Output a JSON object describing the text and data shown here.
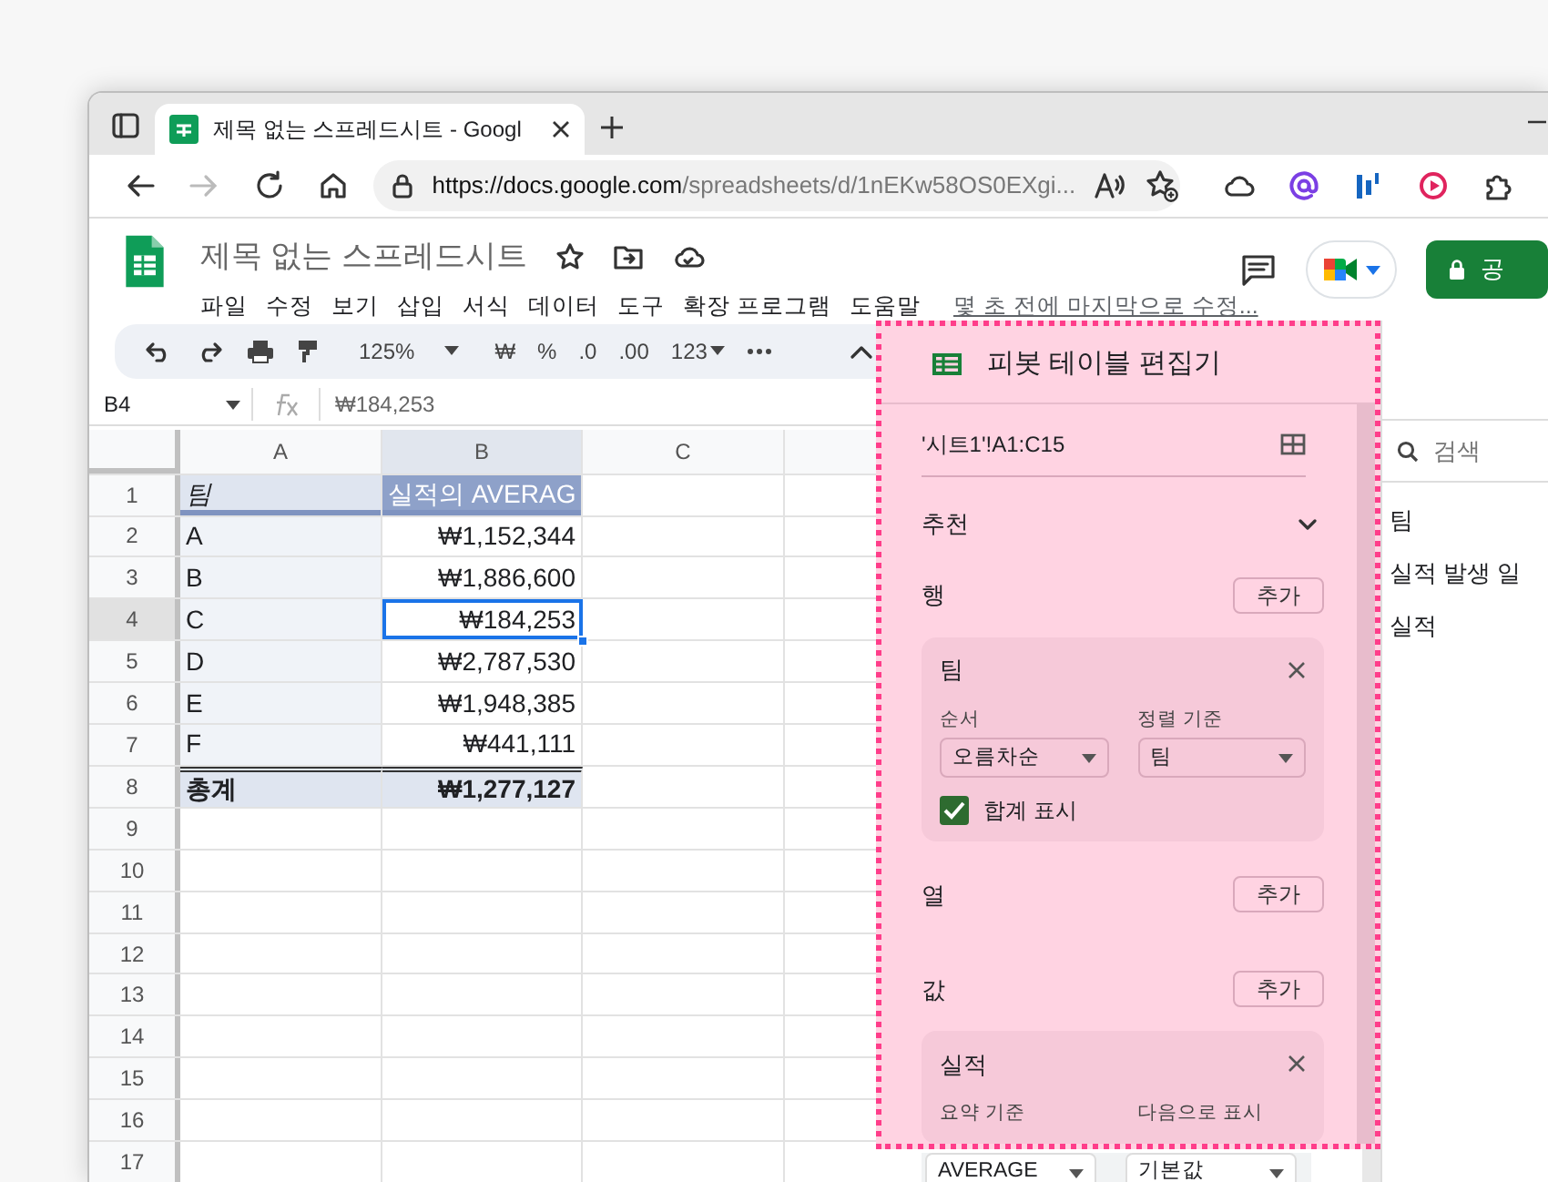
{
  "browser": {
    "tab_title": "제목 없는 스프레드시트 - Googl",
    "url_host": "https://docs.google.com",
    "url_path": "/spreadsheets/d/1nEKw58OS0EXgi..."
  },
  "app": {
    "doc_title": "제목 없는 스프레드시트",
    "menus": [
      "파일",
      "수정",
      "보기",
      "삽입",
      "서식",
      "데이터",
      "도구",
      "확장 프로그램",
      "도움말"
    ],
    "last_edit": "몇 초 전에 마지막으로 수정...",
    "share_button": "공"
  },
  "toolbar": {
    "zoom": "125%",
    "format_items": [
      "₩",
      "%",
      ".0",
      ".00",
      "123"
    ]
  },
  "formula_bar": {
    "cell_ref": "B4",
    "value": "₩184,253"
  },
  "grid": {
    "columns": [
      {
        "label": "A",
        "selected": false
      },
      {
        "label": "B",
        "selected": true
      },
      {
        "label": "C",
        "selected": false
      }
    ],
    "rows": [
      {
        "number": "1",
        "selected": false,
        "kind": "header",
        "cells": [
          {
            "text": "팀",
            "selected": false
          },
          {
            "text": "실적의 AVERAG",
            "selected": false
          }
        ]
      },
      {
        "number": "2",
        "selected": false,
        "kind": "body",
        "cells": [
          {
            "text": "A",
            "selected": false
          },
          {
            "text": "₩1,152,344",
            "selected": false
          }
        ]
      },
      {
        "number": "3",
        "selected": false,
        "kind": "body",
        "cells": [
          {
            "text": "B",
            "selected": false
          },
          {
            "text": "₩1,886,600",
            "selected": false
          }
        ]
      },
      {
        "number": "4",
        "selected": true,
        "kind": "body",
        "cells": [
          {
            "text": "C",
            "selected": false
          },
          {
            "text": "₩184,253",
            "selected": true
          }
        ]
      },
      {
        "number": "5",
        "selected": false,
        "kind": "body",
        "cells": [
          {
            "text": "D",
            "selected": false
          },
          {
            "text": "₩2,787,530",
            "selected": false
          }
        ]
      },
      {
        "number": "6",
        "selected": false,
        "kind": "body",
        "cells": [
          {
            "text": "E",
            "selected": false
          },
          {
            "text": "₩1,948,385",
            "selected": false
          }
        ]
      },
      {
        "number": "7",
        "selected": false,
        "kind": "body",
        "cells": [
          {
            "text": "F",
            "selected": false
          },
          {
            "text": "₩441,111",
            "selected": false
          }
        ]
      },
      {
        "number": "8",
        "selected": false,
        "kind": "total",
        "cells": [
          {
            "text": "총계",
            "selected": false
          },
          {
            "text": "₩1,277,127",
            "selected": false
          }
        ]
      },
      {
        "number": "9",
        "selected": false,
        "kind": "empty"
      },
      {
        "number": "10",
        "selected": false,
        "kind": "empty"
      },
      {
        "number": "11",
        "selected": false,
        "kind": "empty"
      },
      {
        "number": "12",
        "selected": false,
        "kind": "empty"
      },
      {
        "number": "13",
        "selected": false,
        "kind": "empty"
      },
      {
        "number": "14",
        "selected": false,
        "kind": "empty"
      },
      {
        "number": "15",
        "selected": false,
        "kind": "empty"
      },
      {
        "number": "16",
        "selected": false,
        "kind": "empty"
      },
      {
        "number": "17",
        "selected": false,
        "kind": "empty"
      }
    ]
  },
  "pivot_editor": {
    "title": "피봇 테이블 편집기",
    "range": "'시트1'!A1:C15",
    "suggested": "추천",
    "sections": [
      {
        "label": "행",
        "add_button": "추가",
        "fields": [
          {
            "name": "팀",
            "dropdowns": [
              {
                "label": "순서",
                "value": "오름차순"
              },
              {
                "label": "정렬 기준",
                "value": "팀"
              }
            ],
            "checkbox": {
              "label": "합계 표시",
              "checked": true
            }
          }
        ]
      },
      {
        "label": "열",
        "add_button": "추가"
      },
      {
        "label": "값",
        "add_button": "추가",
        "fields": [
          {
            "name": "실적",
            "dropdowns": [
              {
                "label": "요약 기준",
                "value": "AVERAGE"
              },
              {
                "label": "다음으로 표시",
                "value": "기본값"
              }
            ]
          }
        ]
      }
    ]
  },
  "field_list": {
    "search_placeholder": "검색",
    "items": [
      "팀",
      "실적 발생 일",
      "실적"
    ]
  }
}
